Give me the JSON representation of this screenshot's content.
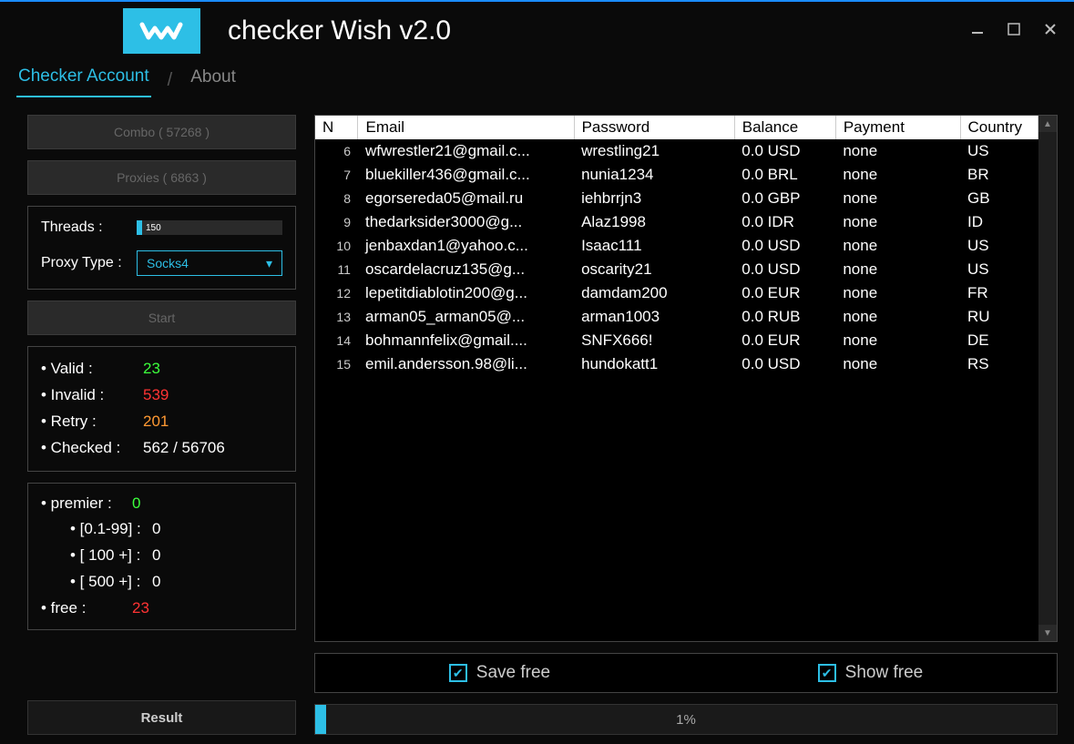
{
  "app": {
    "title": "checker Wish v2.0"
  },
  "tabs": {
    "checker": "Checker Account",
    "about": "About"
  },
  "sidebar": {
    "combo_btn": "Combo ( 57268 )",
    "proxies_btn": "Proxies ( 6863 )",
    "threads_label": "Threads :",
    "threads_value": "150",
    "proxy_type_label": "Proxy Type :",
    "proxy_type_value": "Socks4",
    "start_btn": "Start",
    "result_btn": "Result"
  },
  "stats": {
    "valid_label": "• Valid :",
    "valid_value": "23",
    "invalid_label": "• Invalid :",
    "invalid_value": "539",
    "retry_label": "• Retry :",
    "retry_value": "201",
    "checked_label": "• Checked :",
    "checked_value": "562 / 56706"
  },
  "premier": {
    "premier_label": "• premier :",
    "premier_value": "0",
    "r1_label": "• [0.1-99] :",
    "r1_value": "0",
    "r2_label": "• [ 100 +] :",
    "r2_value": "0",
    "r3_label": "• [ 500 +] :",
    "r3_value": "0",
    "free_label": "• free  :",
    "free_value": "23"
  },
  "table": {
    "headers": {
      "n": "N",
      "email": "Email",
      "password": "Password",
      "balance": "Balance",
      "payment": "Payment",
      "country": "Country"
    },
    "rows": [
      {
        "n": "6",
        "email": "wfwrestler21@gmail.c...",
        "password": "wrestling21",
        "balance": "0.0 USD",
        "payment": "none",
        "country": "US"
      },
      {
        "n": "7",
        "email": "bluekiller436@gmail.c...",
        "password": "nunia1234",
        "balance": "0.0 BRL",
        "payment": "none",
        "country": "BR"
      },
      {
        "n": "8",
        "email": "egorsereda05@mail.ru",
        "password": "iehbrrjn3",
        "balance": "0.0 GBP",
        "payment": "none",
        "country": "GB"
      },
      {
        "n": "9",
        "email": "thedarksider3000@g...",
        "password": "Alaz1998",
        "balance": "0.0 IDR",
        "payment": "none",
        "country": "ID"
      },
      {
        "n": "10",
        "email": "jenbaxdan1@yahoo.c...",
        "password": "Isaac111",
        "balance": "0.0 USD",
        "payment": "none",
        "country": "US"
      },
      {
        "n": "11",
        "email": "oscardelacruz135@g...",
        "password": "oscarity21",
        "balance": "0.0 USD",
        "payment": "none",
        "country": "US"
      },
      {
        "n": "12",
        "email": "lepetitdiablotin200@g...",
        "password": "damdam200",
        "balance": "0.0 EUR",
        "payment": "none",
        "country": "FR"
      },
      {
        "n": "13",
        "email": "arman05_arman05@...",
        "password": "arman1003",
        "balance": "0.0 RUB",
        "payment": "none",
        "country": "RU"
      },
      {
        "n": "14",
        "email": "bohmannfelix@gmail....",
        "password": "SNFX666!",
        "balance": "0.0 EUR",
        "payment": "none",
        "country": "DE"
      },
      {
        "n": "15",
        "email": "emil.andersson.98@li...",
        "password": "hundokatt1",
        "balance": "0.0 USD",
        "payment": "none",
        "country": "RS"
      }
    ]
  },
  "checks": {
    "save_free": "Save free",
    "show_free": "Show free"
  },
  "progress": {
    "text": "1%"
  }
}
